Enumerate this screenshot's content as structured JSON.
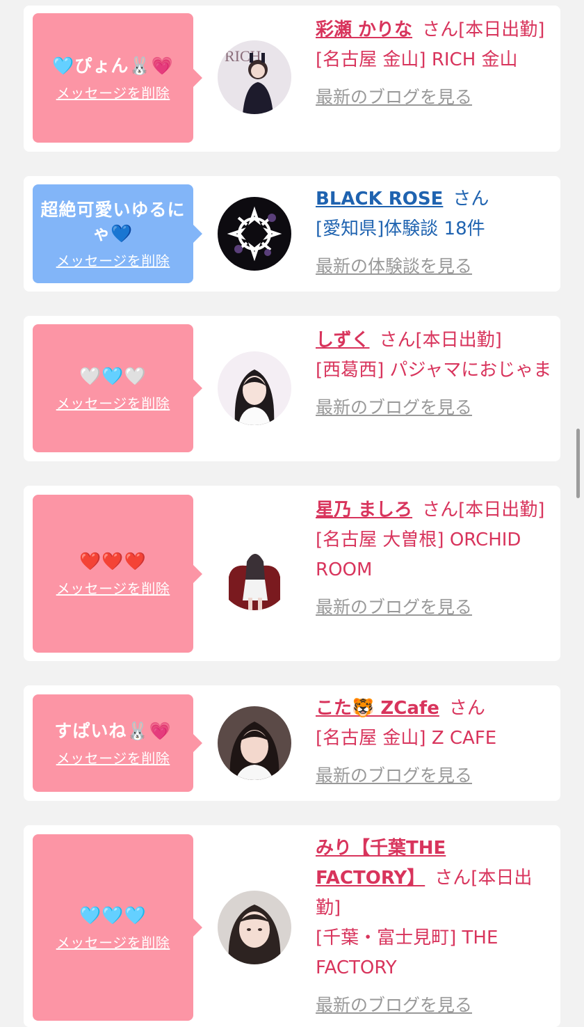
{
  "delete_label": "メッセージを削除",
  "colors": {
    "pink_bubble": "#fc95a5",
    "blue_bubble": "#82b5f8",
    "name_pink": "#d8345c",
    "name_blue": "#1f63b0",
    "link_gray": "#999999"
  },
  "items": [
    {
      "message": "🩵ぴょん🐰💗",
      "name": "彩瀬 かりな",
      "suffix": "さん[本日出勤]",
      "shop": "[名古屋 金山] RICH 金山",
      "link": "最新のブログを見る",
      "avatar": "avatar-photo-icon"
    },
    {
      "message": "超絶可愛いゆるにゃ💙",
      "name": "BLACK ROSE",
      "suffix": "さん",
      "shop": "[愛知県]体験談 18件",
      "link": "最新の体験談を見る",
      "avatar": "rose-emblem-icon"
    },
    {
      "message": "🤍🩵🤍",
      "name": "しずく",
      "suffix": "さん[本日出勤]",
      "shop": "[西葛西] パジャマにおじゃま",
      "link": "最新のブログを見る",
      "avatar": "avatar-photo-icon"
    },
    {
      "message": "❤️❤️❤️",
      "name": "星乃 ましろ",
      "suffix": "さん[本日出勤]",
      "shop": "[名古屋 大曽根] ORCHID ROOM",
      "link": "最新のブログを見る",
      "avatar": "avatar-photo-icon"
    },
    {
      "message": "すぱいね🐰💗",
      "name": "こた🐯 ZCafe",
      "suffix": "さん",
      "shop": "[名古屋 金山] Z CAFE",
      "link": "最新のブログを見る",
      "avatar": "avatar-photo-icon"
    },
    {
      "message": "🩵🩵🩵",
      "name": "みり【千葉THE FACTORY】",
      "suffix": "さん[本日出勤]",
      "shop": "[千葉・富士見町] THE FACTORY",
      "link": "最新のブログを見る",
      "avatar": "avatar-photo-icon"
    }
  ]
}
